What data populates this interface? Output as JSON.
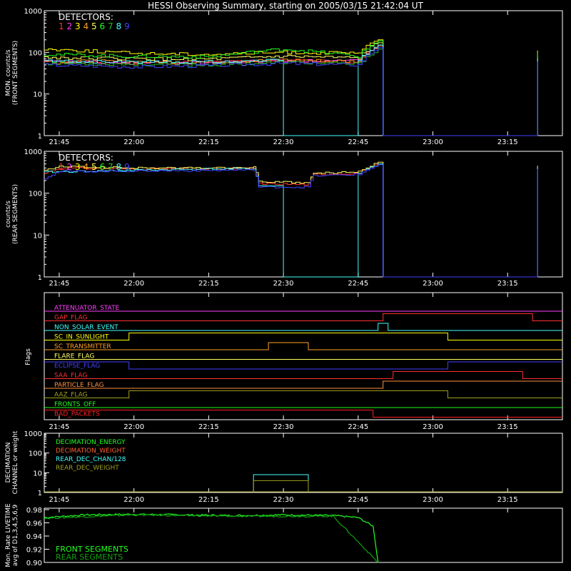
{
  "title": "HESSI Observing Summary, starting on 2005/03/15 21:42:04 UT",
  "x_ticks": [
    "21:45",
    "22:00",
    "22:15",
    "22:30",
    "22:45",
    "23:00",
    "23:15"
  ],
  "x_tick_minutes": [
    3,
    18,
    33,
    48,
    63,
    78,
    93
  ],
  "x_range_minutes": [
    0,
    104
  ],
  "colors": {
    "det": [
      "#ff3030",
      "#ff40ff",
      "#ffff00",
      "#ffa020",
      "#ffff60",
      "#20ff20",
      "#20c020",
      "#40ffff",
      "#4040ff"
    ],
    "axis": "#ffffff"
  },
  "panels": {
    "front": {
      "ylabel1": "MON. counts/s",
      "ylabel2": "(FRONT SEGMENTS)",
      "legend_title": "DETECTORS:",
      "legend_nums": [
        "1",
        "2",
        "3",
        "4",
        "5",
        "6",
        "7",
        "8",
        "9"
      ],
      "y_ticks": [
        "1000",
        "100",
        "10",
        "1"
      ]
    },
    "rear": {
      "ylabel1": "counts/s",
      "ylabel2": "(REAR SEGMENTS)",
      "legend_title": "DETECTORS:",
      "legend_nums": [
        "1",
        "2",
        "3",
        "4",
        "5",
        "6",
        "7",
        "8",
        "9"
      ],
      "y_ticks": [
        "1000",
        "100",
        "10",
        "1"
      ]
    },
    "flags": {
      "ylabel": "Flags",
      "items": [
        {
          "name": "ATTENUATOR_STATE",
          "color": "#ff40ff"
        },
        {
          "name": "GAP_FLAG",
          "color": "#ff3030"
        },
        {
          "name": "NON_SOLAR_EVENT",
          "color": "#40ffff"
        },
        {
          "name": "SC_IN_SUNLIGHT",
          "color": "#ffff00"
        },
        {
          "name": "SC_TRANSMITTER",
          "color": "#ffa020"
        },
        {
          "name": "FLARE_FLAG",
          "color": "#ffff60"
        },
        {
          "name": "ECLIPSE_FLAG",
          "color": "#4040ff"
        },
        {
          "name": "SAA_FLAG",
          "color": "#ff3030"
        },
        {
          "name": "PARTICLE_FLAG",
          "color": "#ff9040"
        },
        {
          "name": "AAZ_FLAG",
          "color": "#a0a020"
        },
        {
          "name": "FRONTS_OFF",
          "color": "#20ff20"
        },
        {
          "name": "BAD_PACKETS",
          "color": "#ff2020"
        }
      ]
    },
    "decimation": {
      "ylabel1": "DECIMATION",
      "ylabel2": "CHANNEL or weight",
      "y_ticks": [
        "1000",
        "100",
        "10",
        "1"
      ],
      "legend": [
        {
          "name": "DECIMATION_ENERGY",
          "color": "#20ff20"
        },
        {
          "name": "DECIMATION_WEIGHT",
          "color": "#ff6030"
        },
        {
          "name": "REAR_DEC_CHAN/128",
          "color": "#40ffff"
        },
        {
          "name": "REAR_DEC_WEIGHT",
          "color": "#a0a020"
        }
      ]
    },
    "livetime": {
      "ylabel1": "Mon. Rate LIVETIME",
      "ylabel2": "avg of D1,3,4,5,6,9",
      "y_ticks": [
        "0.98",
        "0.96",
        "0.94",
        "0.92",
        "0.90"
      ],
      "legend": [
        {
          "name": "FRONT SEGMENTS",
          "color": "#20ff20"
        },
        {
          "name": "REAR SEGMENTS",
          "color": "#10a010"
        }
      ]
    }
  },
  "chart_data": [
    {
      "type": "line",
      "title": "HESSI Observing Summary, starting on 2005/03/15 21:42:04 UT",
      "ylabel": "MON. counts/s (FRONT SEGMENTS)",
      "yscale": "log",
      "ylim": [
        1,
        1000
      ],
      "x_unit": "UT",
      "series": [
        {
          "name": "1",
          "x": [
            "21:42",
            "22:00",
            "22:15",
            "22:30",
            "22:45",
            "22:49",
            "22:50",
            "23:20",
            "23:21"
          ],
          "values": [
            58,
            56,
            58,
            64,
            60,
            140,
            1,
            1,
            70
          ]
        },
        {
          "name": "2",
          "x": [
            "21:42",
            "22:00",
            "22:15",
            "22:30",
            "22:45",
            "22:49",
            "22:50",
            "23:20",
            "23:21"
          ],
          "values": [
            60,
            55,
            57,
            62,
            62,
            150,
            1,
            1,
            75
          ]
        },
        {
          "name": "3",
          "x": [
            "21:42",
            "22:00",
            "22:15",
            "22:30",
            "22:45",
            "22:49",
            "22:50",
            "23:20",
            "23:21"
          ],
          "values": [
            120,
            95,
            90,
            100,
            95,
            200,
            1,
            1,
            110
          ]
        },
        {
          "name": "4",
          "x": [
            "21:42",
            "22:00",
            "22:15",
            "22:30",
            "22:45",
            "22:49",
            "22:50",
            "23:20",
            "23:21"
          ],
          "values": [
            62,
            60,
            58,
            66,
            60,
            150,
            1,
            1,
            72
          ]
        },
        {
          "name": "5",
          "x": [
            "21:42",
            "22:00",
            "22:15",
            "22:30",
            "22:45",
            "22:49",
            "22:50",
            "23:20",
            "23:21"
          ],
          "values": [
            75,
            70,
            68,
            80,
            72,
            170,
            1,
            1,
            85
          ]
        },
        {
          "name": "6",
          "x": [
            "21:42",
            "22:00",
            "22:15",
            "22:30",
            "22:45",
            "22:49",
            "22:50",
            "23:20",
            "23:21"
          ],
          "values": [
            90,
            80,
            78,
            120,
            80,
            190,
            1,
            1,
            95
          ]
        },
        {
          "name": "7",
          "x": [
            "21:42",
            "22:00",
            "22:15",
            "22:30",
            "22:45",
            "22:49",
            "22:50",
            "23:20",
            "23:21"
          ],
          "values": [
            55,
            52,
            50,
            58,
            52,
            120,
            1,
            1,
            65
          ]
        },
        {
          "name": "8",
          "x": [
            "21:42",
            "22:00",
            "22:15",
            "22:29",
            "22:30",
            "22:36",
            "22:45",
            "22:49",
            "22:50",
            "23:20",
            "23:21"
          ],
          "values": [
            62,
            58,
            60,
            64,
            1,
            1,
            62,
            150,
            1,
            1,
            70
          ]
        },
        {
          "name": "9",
          "x": [
            "21:42",
            "22:00",
            "22:15",
            "22:30",
            "22:45",
            "22:49",
            "22:50",
            "23:20",
            "23:21"
          ],
          "values": [
            50,
            45,
            48,
            55,
            50,
            130,
            1,
            1,
            60
          ]
        }
      ]
    },
    {
      "type": "line",
      "ylabel": "counts/s (REAR SEGMENTS)",
      "yscale": "log",
      "ylim": [
        1,
        1000
      ],
      "series": [
        {
          "name": "1",
          "x": [
            "21:42",
            "21:45",
            "22:00",
            "22:15",
            "22:24",
            "22:25",
            "22:35",
            "22:36",
            "22:45",
            "22:49",
            "22:50",
            "23:20",
            "23:21"
          ],
          "values": [
            300,
            400,
            380,
            380,
            390,
            170,
            160,
            280,
            300,
            500,
            1,
            1,
            400
          ]
        },
        {
          "name": "5",
          "x": [
            "21:42",
            "21:45",
            "22:00",
            "22:15",
            "22:24",
            "22:25",
            "22:35",
            "22:36",
            "22:45",
            "22:49",
            "22:50",
            "23:20",
            "23:21"
          ],
          "values": [
            350,
            430,
            400,
            400,
            410,
            190,
            175,
            300,
            320,
            550,
            1,
            1,
            450
          ]
        },
        {
          "name": "8",
          "x": [
            "21:42",
            "22:15",
            "22:24",
            "22:25",
            "22:29",
            "22:30",
            "22:36",
            "22:45",
            "22:49",
            "22:50",
            "23:20",
            "23:21"
          ],
          "values": [
            320,
            380,
            380,
            150,
            150,
            1,
            1,
            290,
            500,
            1,
            1,
            420
          ]
        },
        {
          "name": "9",
          "x": [
            "21:42",
            "21:45",
            "22:00",
            "22:15",
            "22:24",
            "22:25",
            "22:35",
            "22:36",
            "22:45",
            "22:49",
            "22:50",
            "23:20",
            "23:21"
          ],
          "values": [
            230,
            330,
            340,
            350,
            360,
            140,
            140,
            260,
            280,
            480,
            1,
            1,
            380
          ]
        }
      ]
    },
    {
      "type": "line",
      "ylabel": "Flags",
      "series": [
        {
          "name": "GAP_FLAG",
          "x": [
            "21:42",
            "22:50",
            "22:50",
            "23:20",
            "23:20"
          ],
          "values": [
            0,
            0,
            1,
            1,
            0
          ]
        },
        {
          "name": "NON_SOLAR_EVENT",
          "x": [
            "21:42",
            "22:49",
            "22:49",
            "22:51",
            "22:51"
          ],
          "values": [
            0,
            0,
            1,
            1,
            0
          ]
        },
        {
          "name": "SC_IN_SUNLIGHT",
          "x": [
            "21:42",
            "21:59",
            "21:59",
            "23:03",
            "23:03"
          ],
          "values": [
            0,
            0,
            1,
            1,
            0
          ]
        },
        {
          "name": "SC_TRANSMITTER",
          "x": [
            "21:42",
            "22:27",
            "22:27",
            "22:35",
            "22:35"
          ],
          "values": [
            0,
            0,
            1,
            1,
            0
          ]
        },
        {
          "name": "ECLIPSE_FLAG",
          "x": [
            "21:42",
            "21:59",
            "21:59",
            "23:03",
            "23:03"
          ],
          "values": [
            1,
            1,
            0,
            0,
            1
          ]
        },
        {
          "name": "SAA_FLAG",
          "x": [
            "21:42",
            "22:52",
            "22:52",
            "23:18",
            "23:18"
          ],
          "values": [
            0,
            0,
            1,
            1,
            0
          ]
        },
        {
          "name": "PARTICLE_FLAG",
          "x": [
            "21:42",
            "22:50",
            "22:50",
            "23:20"
          ],
          "values": [
            0,
            0,
            1,
            1
          ]
        },
        {
          "name": "AAZ_FLAG",
          "x": [
            "21:42",
            "21:59",
            "21:59",
            "23:03",
            "23:03"
          ],
          "values": [
            0,
            0,
            1,
            1,
            0
          ]
        },
        {
          "name": "BAD_PACKETS",
          "x": [
            "21:42",
            "22:48",
            "22:48"
          ],
          "values": [
            1,
            1,
            0
          ]
        }
      ]
    },
    {
      "type": "line",
      "ylabel": "DECIMATION CHANNEL or weight",
      "yscale": "log",
      "ylim": [
        1,
        1000
      ],
      "series": [
        {
          "name": "REAR_DEC_CHAN/128",
          "x": [
            "22:24",
            "22:24",
            "22:35",
            "22:35"
          ],
          "values": [
            1,
            8,
            8,
            1
          ]
        },
        {
          "name": "REAR_DEC_WEIGHT",
          "x": [
            "22:24",
            "22:24",
            "22:35",
            "22:35"
          ],
          "values": [
            1,
            4,
            4,
            1
          ]
        }
      ]
    },
    {
      "type": "line",
      "ylabel": "Mon. Rate LIVETIME avg of D1,3,4,5,6,9",
      "ylim": [
        0.9,
        0.98
      ],
      "series": [
        {
          "name": "FRONT SEGMENTS",
          "x": [
            "21:42",
            "21:50",
            "22:00",
            "22:10",
            "22:20",
            "22:30",
            "22:40",
            "22:45",
            "22:48",
            "22:49"
          ],
          "values": [
            0.968,
            0.972,
            0.973,
            0.972,
            0.971,
            0.972,
            0.971,
            0.968,
            0.955,
            0.9
          ]
        },
        {
          "name": "REAR SEGMENTS",
          "x": [
            "21:42",
            "22:00",
            "22:20",
            "22:40",
            "22:49"
          ],
          "values": [
            0.967,
            0.972,
            0.97,
            0.97,
            0.9
          ]
        }
      ]
    }
  ]
}
